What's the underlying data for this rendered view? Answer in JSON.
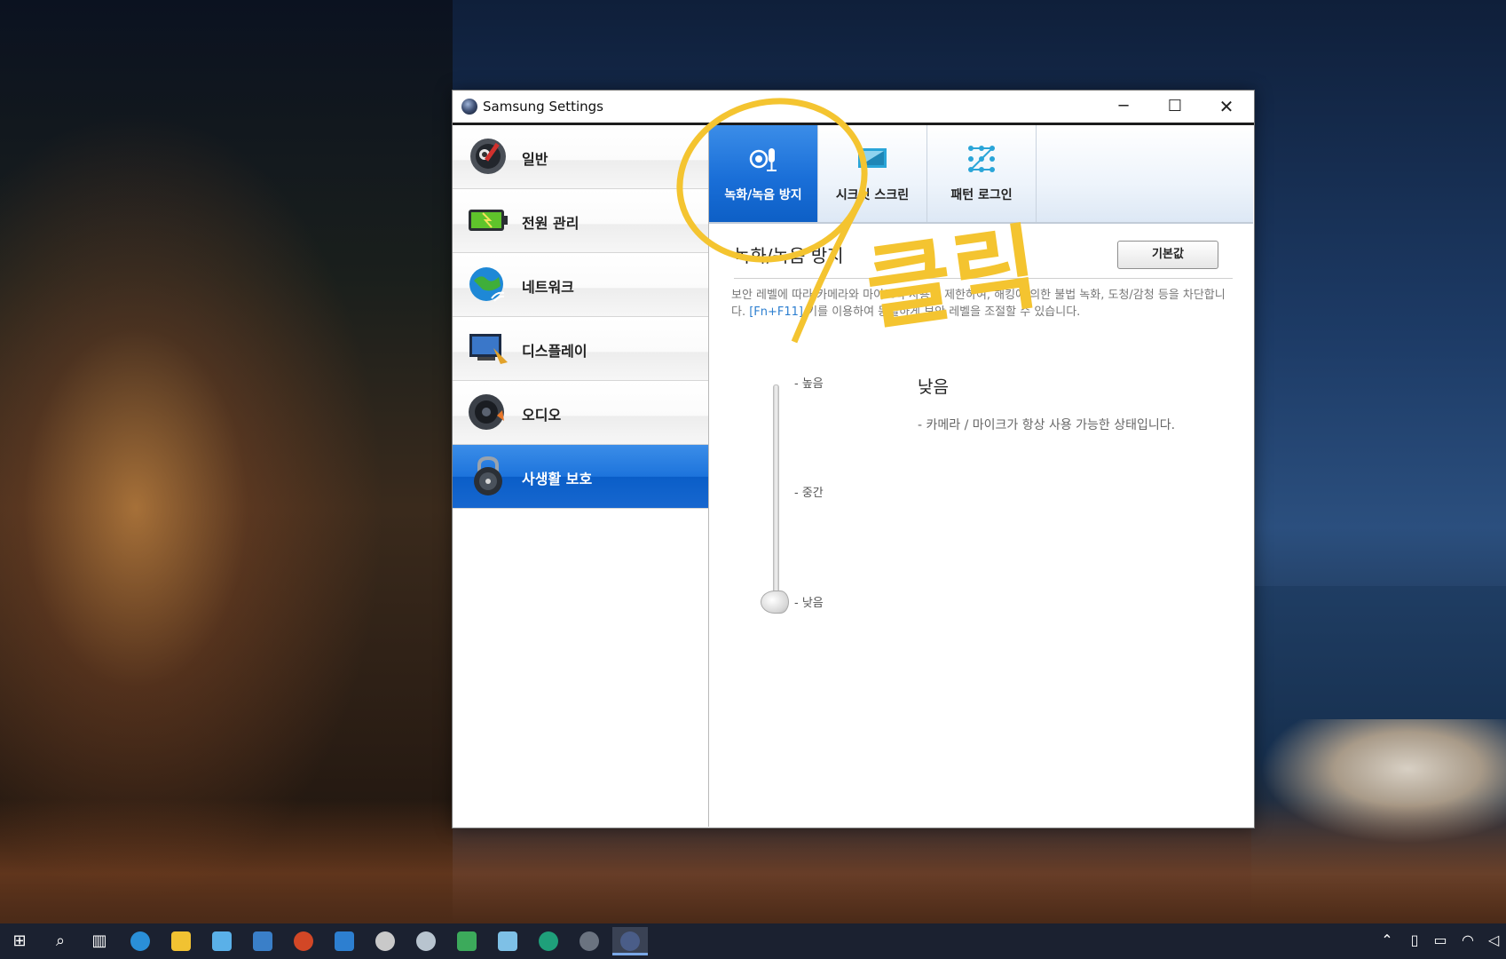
{
  "window": {
    "title": "Samsung Settings",
    "controls": {
      "minimize": "─",
      "maximize": "☐",
      "close": "✕"
    }
  },
  "sidebar": {
    "items": [
      {
        "label": "일반",
        "icon": "general-settings-icon",
        "active": false
      },
      {
        "label": "전원 관리",
        "icon": "battery-icon",
        "active": false
      },
      {
        "label": "네트워크",
        "icon": "network-globe-icon",
        "active": false
      },
      {
        "label": "디스플레이",
        "icon": "display-icon",
        "active": false
      },
      {
        "label": "오디오",
        "icon": "speaker-icon",
        "active": false
      },
      {
        "label": "사생활 보호",
        "icon": "padlock-icon",
        "active": true
      }
    ]
  },
  "tabs": [
    {
      "label": "녹화/녹음 방지",
      "icon": "camera-mic-icon",
      "active": true
    },
    {
      "label": "시크릿 스크린",
      "icon": "secret-screen-icon",
      "active": false
    },
    {
      "label": "패턴 로그인",
      "icon": "pattern-login-icon",
      "active": false
    }
  ],
  "section": {
    "title": "녹화/녹음 방지",
    "default_button": "기본값",
    "description_part1": "보안 레벨에 따라 카메라와 마이크의 사용을 제한하여, 해킹에 의한 불법 녹화, 도청/감청 등을 차단합니다. ",
    "description_shortcut": "[Fn+F11]",
    "description_part2": " 키를 이용하여 동일하게 보안 레벨을 조절할 수 있습니다."
  },
  "security_level": {
    "levels": {
      "high": "- 높음",
      "mid": "- 중간",
      "low": "- 낮음"
    },
    "current": "낮음",
    "current_description": "- 카메라 / 마이크가 항상 사용 가능한 상태입니다.",
    "value": "low"
  },
  "annotation": {
    "text": "클릭",
    "color": "#f4c430"
  },
  "colors": {
    "active_blue": "#1d74dc",
    "link_blue": "#2d7fd0"
  }
}
